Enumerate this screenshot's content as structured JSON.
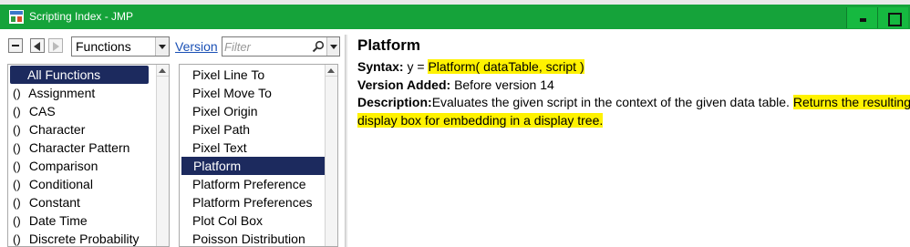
{
  "window": {
    "title": "Scripting Index - JMP"
  },
  "toolbar": {
    "dropdown_value": "Functions",
    "version_link": "Version",
    "filter_placeholder": "Filter"
  },
  "categories": [
    {
      "label": "All Functions",
      "paren": ""
    },
    {
      "label": "Assignment",
      "paren": "()"
    },
    {
      "label": "CAS",
      "paren": "()"
    },
    {
      "label": "Character",
      "paren": "()"
    },
    {
      "label": "Character Pattern",
      "paren": "()"
    },
    {
      "label": "Comparison",
      "paren": "()"
    },
    {
      "label": "Conditional",
      "paren": "()"
    },
    {
      "label": "Constant",
      "paren": "()"
    },
    {
      "label": "Date Time",
      "paren": "()"
    },
    {
      "label": "Discrete Probability",
      "paren": "()"
    }
  ],
  "functions": [
    "Pixel Line To",
    "Pixel Move To",
    "Pixel Origin",
    "Pixel Path",
    "Pixel Text",
    "Platform",
    "Platform Preference",
    "Platform Preferences",
    "Plot Col Box",
    "Poisson Distribution"
  ],
  "selected_category": "All Functions",
  "selected_function": "Platform",
  "detail": {
    "title": "Platform",
    "syntax_label": "Syntax:",
    "syntax_prefix": "y = ",
    "syntax_code": "Platform( dataTable, script )",
    "version_label": "Version Added:",
    "version_value": "Before version 14",
    "desc_label": "Description:",
    "desc_plain": "Evaluates the given script in the context of the given data table. ",
    "desc_highlight_1": "Returns the resulting",
    "desc_highlight_2": "display box for embedding in a display tree."
  },
  "colors": {
    "titlebar": "#15a33a",
    "selection": "#1c2a5e",
    "highlight": "#fff200",
    "link": "#1a50b5"
  },
  "icons": [
    "app-icon",
    "collapse-icon",
    "back-arrow-icon",
    "forward-arrow-icon",
    "search-icon",
    "chevron-down-icon",
    "minimize-icon",
    "maximize-icon"
  ]
}
